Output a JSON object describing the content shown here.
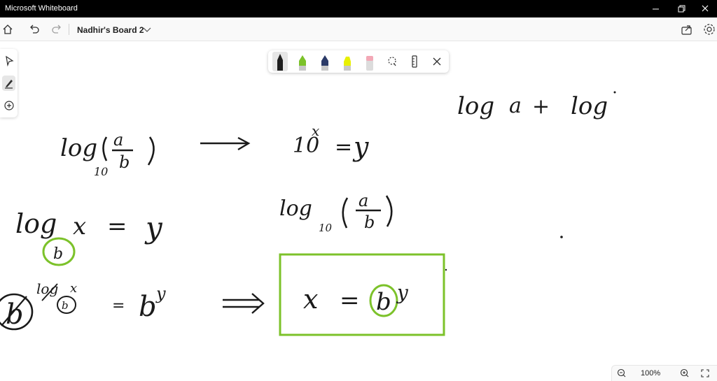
{
  "window": {
    "title": "Microsoft Whiteboard"
  },
  "toolbar": {
    "board_name": "Nadhir's Board 2"
  },
  "zoom": {
    "level": "100%"
  },
  "colors": {
    "ink": "#1a1a1a",
    "highlight_green": "#7cc22a",
    "titlebar": "#000000"
  },
  "pens": [
    {
      "name": "black-pen",
      "color": "#1e1e1e",
      "selected": true
    },
    {
      "name": "green-pen",
      "color": "#7cc22a",
      "selected": false
    },
    {
      "name": "blue-pen",
      "color": "#2b3a67",
      "selected": false
    },
    {
      "name": "yellow-highlighter",
      "color": "#e8f000",
      "selected": false
    },
    {
      "name": "eraser",
      "color": "#f3a8b6",
      "selected": false
    }
  ],
  "ink": {
    "eq_top_left": "log₁₀(a/b)",
    "eq_top_mid": "10ˣ = y",
    "eq_top_right": "log a + log",
    "eq_mid_left_main": "log",
    "eq_mid_left_sub": "b",
    "eq_mid_left_rest": "x = y",
    "eq_mid_center": "log₁₀(a/b)",
    "eq_bottom_left_base": "b",
    "eq_bottom_left_exp": "log",
    "eq_bottom_left_rest": "= bʸ",
    "eq_boxed": "x = bʸ",
    "arrow_single": "⟶",
    "arrow_double": "⟹"
  }
}
